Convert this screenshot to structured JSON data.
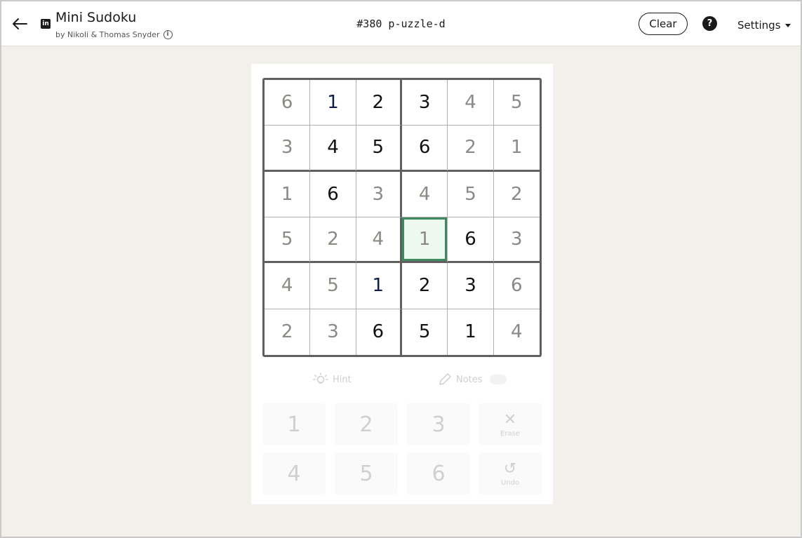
{
  "header": {
    "title": "Mini Sudoku",
    "subtitle": "by Nikoli & Thomas Snyder",
    "logo_text": "in",
    "info_symbol": "i",
    "puzzle_id": "#380 p-uzzle-d",
    "clear_label": "Clear",
    "help_symbol": "?",
    "settings_label": "Settings"
  },
  "board": {
    "rows": [
      [
        "6",
        "1",
        "2",
        "3",
        "4",
        "5"
      ],
      [
        "3",
        "4",
        "5",
        "6",
        "2",
        "1"
      ],
      [
        "1",
        "6",
        "3",
        "4",
        "5",
        "2"
      ],
      [
        "5",
        "2",
        "4",
        "1",
        "6",
        "3"
      ],
      [
        "4",
        "5",
        "1",
        "2",
        "3",
        "6"
      ],
      [
        "2",
        "3",
        "6",
        "5",
        "1",
        "4"
      ]
    ],
    "selected": "row 4, column 4"
  },
  "tools": {
    "hint_label": "Hint",
    "notes_label": "Notes"
  },
  "keypad": {
    "keys": [
      "1",
      "2",
      "3",
      "4",
      "5",
      "6"
    ],
    "erase_label": "Erase",
    "undo_label": "Undo",
    "erase_symbol": "✕",
    "undo_symbol": "↺"
  },
  "colors": {
    "background": "#f3f0ec",
    "selected_border": "#3c8a5e",
    "selected_fill": "#edf9ef",
    "given_digit": "#111111",
    "filled_digit": "#8a8a85"
  }
}
